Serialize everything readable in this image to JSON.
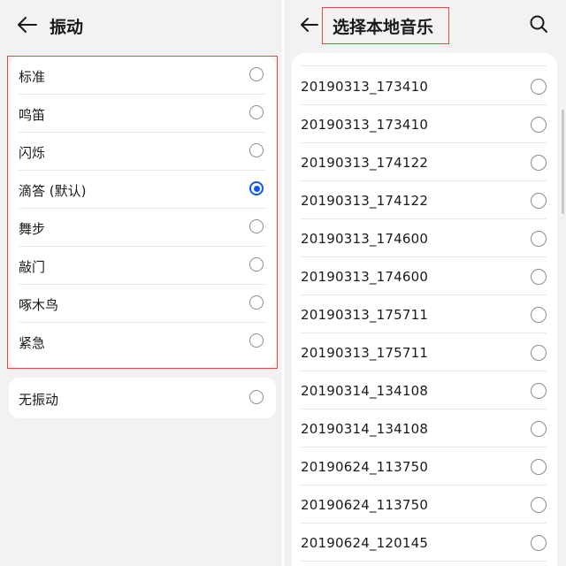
{
  "left": {
    "title": "振动",
    "options": [
      {
        "label": "标准",
        "checked": false
      },
      {
        "label": "鸣笛",
        "checked": false
      },
      {
        "label": "闪烁",
        "checked": false
      },
      {
        "label": "滴答 (默认)",
        "checked": true
      },
      {
        "label": "舞步",
        "checked": false
      },
      {
        "label": "敲门",
        "checked": false
      },
      {
        "label": "啄木鸟",
        "checked": false
      },
      {
        "label": "紧急",
        "checked": false
      }
    ],
    "no_vibration": {
      "label": "无振动",
      "checked": false
    }
  },
  "right": {
    "title": "选择本地音乐",
    "songs": [
      "20190313_173410",
      "20190313_173410",
      "20190313_174122",
      "20190313_174122",
      "20190313_174600",
      "20190313_174600",
      "20190313_175711",
      "20190313_175711",
      "20190314_134108",
      "20190314_134108",
      "20190624_113750",
      "20190624_113750",
      "20190624_120145"
    ]
  },
  "colors": {
    "accent": "#0a59f7",
    "highlight_box": "#e04848",
    "background": "#f2f2f2"
  },
  "icons": {
    "back": "back-arrow-icon",
    "search": "search-icon"
  }
}
